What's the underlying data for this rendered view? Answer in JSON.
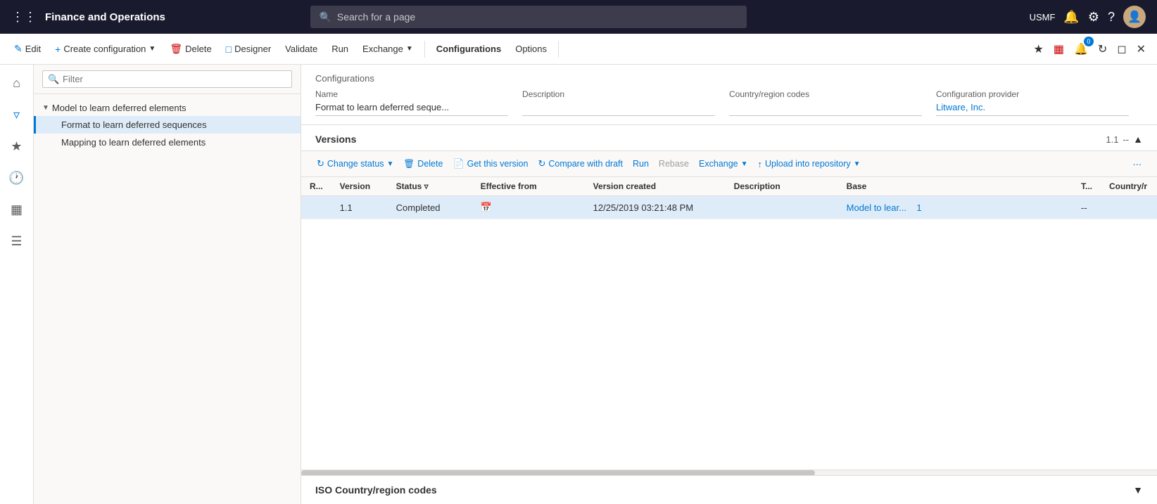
{
  "app": {
    "title": "Finance and Operations"
  },
  "search": {
    "placeholder": "Search for a page"
  },
  "topnav": {
    "user": "USMF"
  },
  "toolbar": {
    "edit": "Edit",
    "create_config": "Create configuration",
    "delete": "Delete",
    "designer": "Designer",
    "validate": "Validate",
    "run": "Run",
    "exchange": "Exchange",
    "configurations": "Configurations",
    "options": "Options"
  },
  "tree": {
    "filter_placeholder": "Filter",
    "root_item": "Model to learn deferred elements",
    "items": [
      {
        "label": "Format to learn deferred sequences",
        "selected": true
      },
      {
        "label": "Mapping to learn deferred elements",
        "selected": false
      }
    ]
  },
  "config_header": {
    "section_title": "Configurations",
    "fields": [
      {
        "label": "Name",
        "value": "Format to learn deferred seque...",
        "link": false
      },
      {
        "label": "Description",
        "value": "",
        "link": false
      },
      {
        "label": "Country/region codes",
        "value": "",
        "link": false
      },
      {
        "label": "Configuration provider",
        "value": "Litware, Inc.",
        "link": true
      }
    ]
  },
  "versions": {
    "title": "Versions",
    "version_display": "1.1",
    "separator": "--",
    "toolbar": {
      "change_status": "Change status",
      "delete": "Delete",
      "get_this_version": "Get this version",
      "compare_with_draft": "Compare with draft",
      "run": "Run",
      "rebase": "Rebase",
      "exchange": "Exchange",
      "upload_into_repository": "Upload into repository"
    },
    "table": {
      "columns": [
        "R...",
        "Version",
        "Status",
        "Effective from",
        "Version created",
        "Description",
        "Base",
        "T...",
        "Country/r"
      ],
      "rows": [
        {
          "r": "",
          "version": "1.1",
          "status": "Completed",
          "effective_from": "",
          "version_created": "12/25/2019 03:21:48 PM",
          "description": "",
          "base": "Model to lear...",
          "base_num": "1",
          "t": "--",
          "country": ""
        }
      ]
    }
  },
  "iso_section": {
    "title": "ISO Country/region codes"
  }
}
